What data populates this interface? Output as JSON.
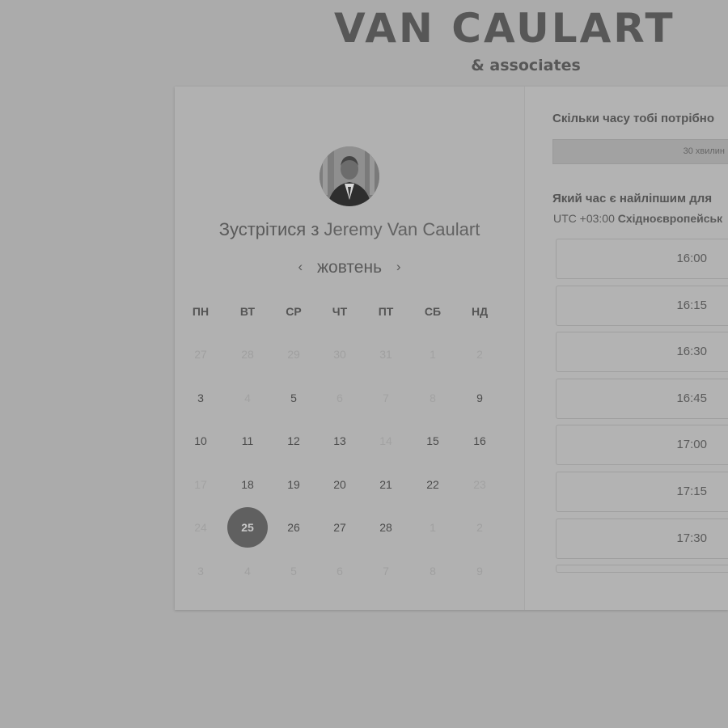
{
  "brand": {
    "title": "VAN CAULART",
    "subtitle": "& associates"
  },
  "host": {
    "avatar": "profile-photo",
    "meet_prefix": "Зустрітися з",
    "name": "Jeremy Van Caulart"
  },
  "calendar": {
    "month": "жовтень",
    "prev_icon": "chevron-left-icon",
    "next_icon": "chevron-right-icon",
    "weekdays": [
      "ПН",
      "ВТ",
      "СР",
      "ЧТ",
      "ПТ",
      "СБ",
      "НД"
    ],
    "weeks": [
      [
        {
          "label": "27",
          "state": "other"
        },
        {
          "label": "28",
          "state": "other"
        },
        {
          "label": "29",
          "state": "other"
        },
        {
          "label": "30",
          "state": "other"
        },
        {
          "label": "31",
          "state": "other"
        },
        {
          "label": "1",
          "state": "inactive"
        },
        {
          "label": "2",
          "state": "inactive"
        }
      ],
      [
        {
          "label": "3",
          "state": "available"
        },
        {
          "label": "4",
          "state": "inactive"
        },
        {
          "label": "5",
          "state": "available"
        },
        {
          "label": "6",
          "state": "inactive"
        },
        {
          "label": "7",
          "state": "inactive"
        },
        {
          "label": "8",
          "state": "inactive"
        },
        {
          "label": "9",
          "state": "available"
        }
      ],
      [
        {
          "label": "10",
          "state": "available"
        },
        {
          "label": "11",
          "state": "available"
        },
        {
          "label": "12",
          "state": "available"
        },
        {
          "label": "13",
          "state": "available"
        },
        {
          "label": "14",
          "state": "inactive"
        },
        {
          "label": "15",
          "state": "available"
        },
        {
          "label": "16",
          "state": "available"
        }
      ],
      [
        {
          "label": "17",
          "state": "inactive"
        },
        {
          "label": "18",
          "state": "available"
        },
        {
          "label": "19",
          "state": "available"
        },
        {
          "label": "20",
          "state": "available"
        },
        {
          "label": "21",
          "state": "available"
        },
        {
          "label": "22",
          "state": "available"
        },
        {
          "label": "23",
          "state": "inactive"
        }
      ],
      [
        {
          "label": "24",
          "state": "inactive"
        },
        {
          "label": "25",
          "state": "selected"
        },
        {
          "label": "26",
          "state": "available"
        },
        {
          "label": "27",
          "state": "available"
        },
        {
          "label": "28",
          "state": "available"
        },
        {
          "label": "1",
          "state": "other"
        },
        {
          "label": "2",
          "state": "other"
        }
      ],
      [
        {
          "label": "3",
          "state": "other"
        },
        {
          "label": "4",
          "state": "other"
        },
        {
          "label": "5",
          "state": "other"
        },
        {
          "label": "6",
          "state": "other"
        },
        {
          "label": "7",
          "state": "other"
        },
        {
          "label": "8",
          "state": "other"
        },
        {
          "label": "9",
          "state": "other"
        }
      ]
    ]
  },
  "booking": {
    "duration_question": "Скільки часу тобі потрібно",
    "duration_value": "30 хвилин",
    "time_question": "Який час є найліпшим для",
    "timezone_offset": "UTC +03:00",
    "timezone_name": "Східноєвропейськ",
    "slots": [
      "16:00",
      "16:15",
      "16:30",
      "16:45",
      "17:00",
      "17:15",
      "17:30"
    ]
  }
}
